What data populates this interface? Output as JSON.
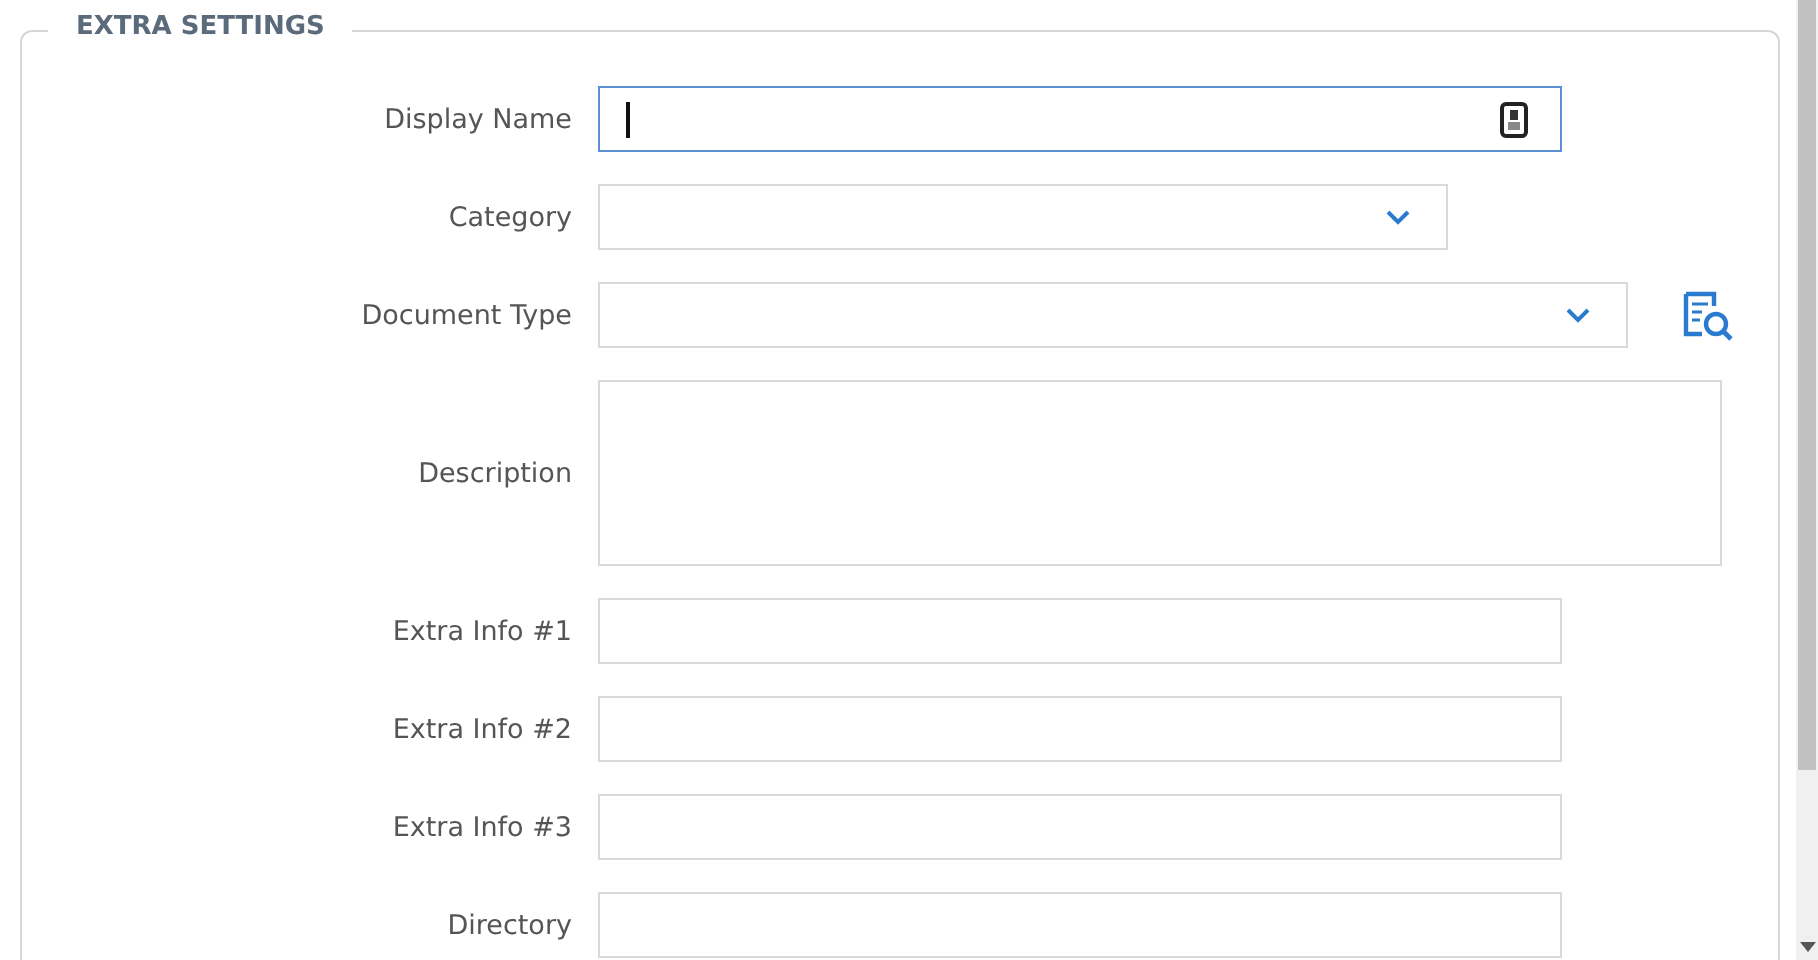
{
  "section": {
    "title": "EXTRA SETTINGS"
  },
  "fields": [
    {
      "label": "Display Name",
      "kind": "id-text",
      "focused": true
    },
    {
      "label": "Category",
      "kind": "select",
      "focused": false
    },
    {
      "label": "Document Type",
      "kind": "lookup-select",
      "focused": false
    },
    {
      "label": "Description",
      "kind": "textarea",
      "focused": false
    },
    {
      "label": "Extra Info #1",
      "kind": "text",
      "focused": false
    },
    {
      "label": "Extra Info #2",
      "kind": "text",
      "focused": false
    },
    {
      "label": "Extra Info #3",
      "kind": "text",
      "focused": false
    },
    {
      "label": "Directory",
      "kind": "text",
      "focused": false
    }
  ]
}
